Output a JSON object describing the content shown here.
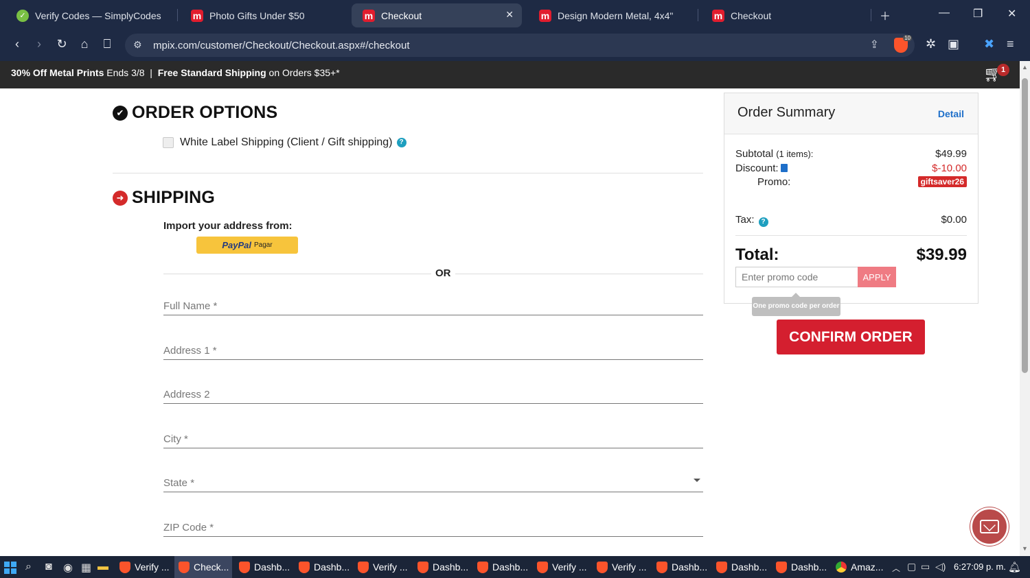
{
  "browser": {
    "tabs": [
      {
        "title": "Verify Codes — SimplyCodes",
        "icon": "simplycodes-icon",
        "active": false
      },
      {
        "title": "Photo Gifts Under $50",
        "icon": "mpix-icon",
        "active": false
      },
      {
        "title": "Checkout",
        "icon": "mpix-icon",
        "active": true
      },
      {
        "title": "Design Modern Metal, 4x4\"",
        "icon": "mpix-icon",
        "active": false
      },
      {
        "title": "Checkout",
        "icon": "mpix-icon",
        "active": false
      }
    ],
    "url": "mpix.com/customer/Checkout/Checkout.aspx#/checkout",
    "extension_badge": "10"
  },
  "banner": {
    "promo1_bold": "30% Off Metal Prints",
    "promo1_rest": " Ends 3/8",
    "separator": "  |  ",
    "promo2_bold": "Free Standard Shipping",
    "promo2_rest": " on Orders $35+*",
    "cart_count": "1"
  },
  "order_options": {
    "title": "ORDER OPTIONS",
    "white_label_label": "White Label Shipping (Client / Gift shipping)"
  },
  "shipping": {
    "title": "SHIPPING",
    "import_label": "Import your address from:",
    "paypal_brand": "PayPal",
    "paypal_action": "Pagar",
    "or_label": "OR",
    "fields": {
      "full_name": "Full Name *",
      "address1": "Address 1 *",
      "address2": "Address 2",
      "city": "City *",
      "state": "State *",
      "zip": "ZIP Code *"
    }
  },
  "summary": {
    "title": "Order Summary",
    "detail_link": "Detail",
    "subtotal_label": "Subtotal",
    "items_note": "(1 items):",
    "subtotal_value": "$49.99",
    "discount_label": "Discount:",
    "discount_value": "$-10.00",
    "promo_label": "Promo:",
    "promo_code": "giftsaver26",
    "tax_label": "Tax:",
    "tax_value": "$0.00",
    "total_label": "Total:",
    "total_value": "$39.99",
    "promo_placeholder": "Enter promo code",
    "apply_label": "APPLY",
    "tooltip": "One promo code per order",
    "confirm_label": "CONFIRM ORDER"
  },
  "taskbar": {
    "items": [
      {
        "label": "Verify ...",
        "icon": "brave-icon",
        "active": false
      },
      {
        "label": "Check...",
        "icon": "brave-icon",
        "active": true
      },
      {
        "label": "Dashb...",
        "icon": "brave-icon",
        "active": false
      },
      {
        "label": "Dashb...",
        "icon": "brave-icon",
        "active": false
      },
      {
        "label": "Verify ...",
        "icon": "brave-icon",
        "active": false
      },
      {
        "label": "Dashb...",
        "icon": "brave-icon",
        "active": false
      },
      {
        "label": "Dashb...",
        "icon": "brave-icon",
        "active": false
      },
      {
        "label": "Verify ...",
        "icon": "brave-icon",
        "active": false
      },
      {
        "label": "Verify ...",
        "icon": "brave-icon",
        "active": false
      },
      {
        "label": "Dashb...",
        "icon": "brave-icon",
        "active": false
      },
      {
        "label": "Dashb...",
        "icon": "brave-icon",
        "active": false
      },
      {
        "label": "Dashb...",
        "icon": "brave-icon",
        "active": false
      },
      {
        "label": "Amaz...",
        "icon": "chrome-icon",
        "active": false
      }
    ],
    "clock": "6:27:09 p. m."
  },
  "colors": {
    "brand_red": "#d41f2f",
    "link_blue": "#1e6fc9",
    "help_teal": "#1e9fbf",
    "apply_pink": "#ef7b83"
  }
}
